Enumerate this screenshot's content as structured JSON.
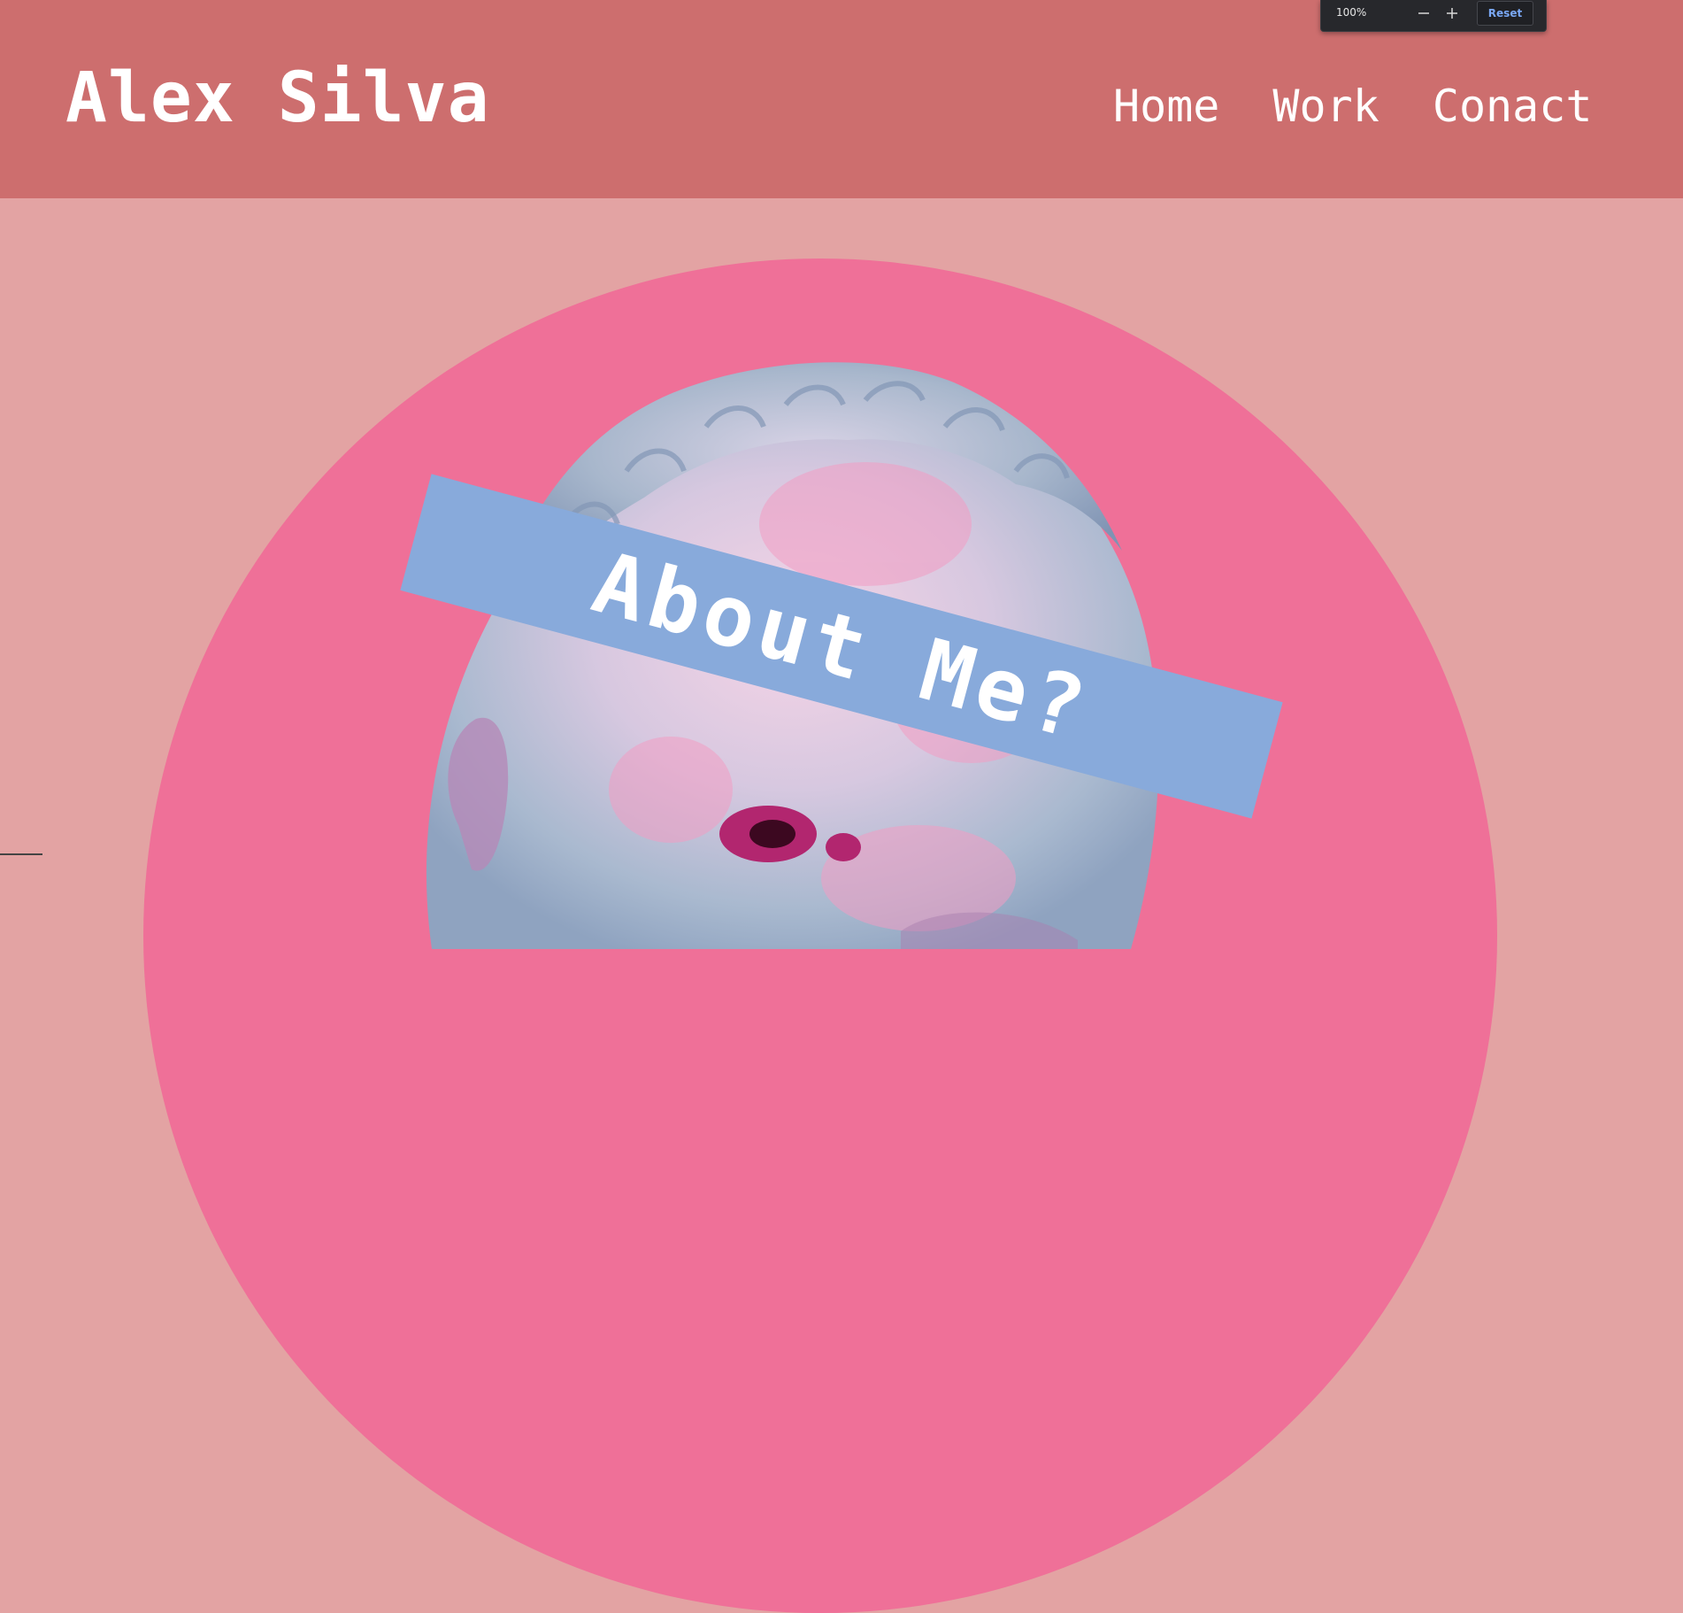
{
  "header": {
    "brand": "Alex Silva",
    "nav": [
      {
        "label": "Home"
      },
      {
        "label": "Work"
      },
      {
        "label": "Conact"
      }
    ]
  },
  "zoom_toolbar": {
    "level": "100%",
    "zoom_out_icon": "minus-icon",
    "zoom_in_icon": "plus-icon",
    "reset_label": "Reset"
  },
  "hero": {
    "banner_text": "About Me?",
    "image": "greek-statue-head"
  },
  "colors": {
    "header_bg": "#cd6e6e",
    "page_bg": "#e3a3a3",
    "circle": "#ef7098",
    "banner": "#88aadb",
    "text": "#ffffff"
  }
}
